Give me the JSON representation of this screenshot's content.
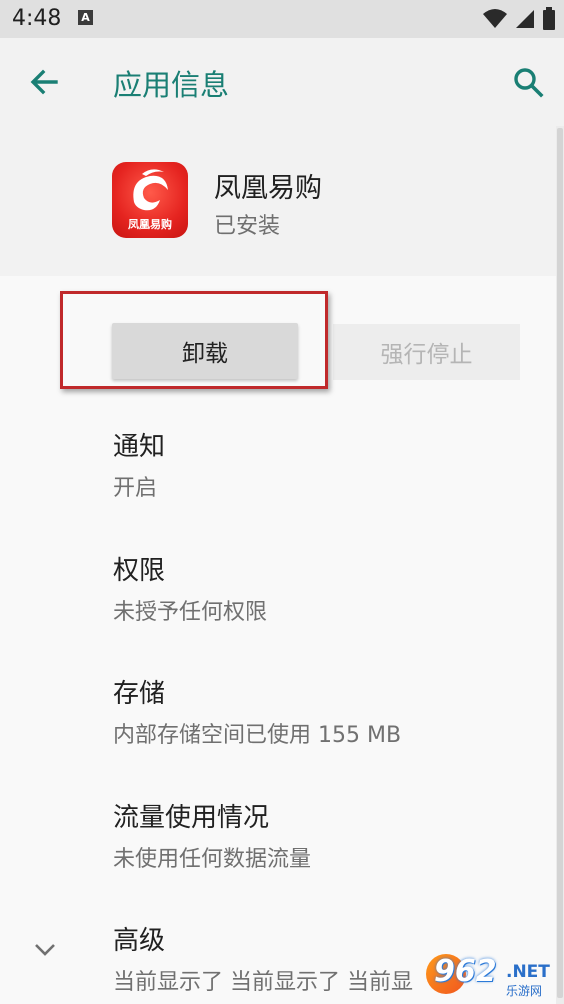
{
  "status_bar": {
    "time": "4:48",
    "notification_letter": "A"
  },
  "app_bar": {
    "title": "应用信息",
    "accent_color": "#1a7f74"
  },
  "app": {
    "name": "凤凰易购",
    "status": "已安装",
    "icon_caption": "凤凰易购"
  },
  "buttons": {
    "uninstall": "卸载",
    "force_stop": "强行停止"
  },
  "settings": [
    {
      "title": "通知",
      "summary": "开启"
    },
    {
      "title": "权限",
      "summary": "未授予任何权限"
    },
    {
      "title": "存储",
      "summary": "内部存储空间已使用 155 MB"
    },
    {
      "title": "流量使用情况",
      "summary": "未使用任何数据流量"
    },
    {
      "title": "高级",
      "summary": "当前显示了 当前显示了 当前显"
    }
  ],
  "watermark": {
    "number": "962",
    "domain": ".NET",
    "subtitle": "乐游网"
  },
  "colors": {
    "highlight_border": "#c0292b",
    "icon_red": "#e52420"
  }
}
